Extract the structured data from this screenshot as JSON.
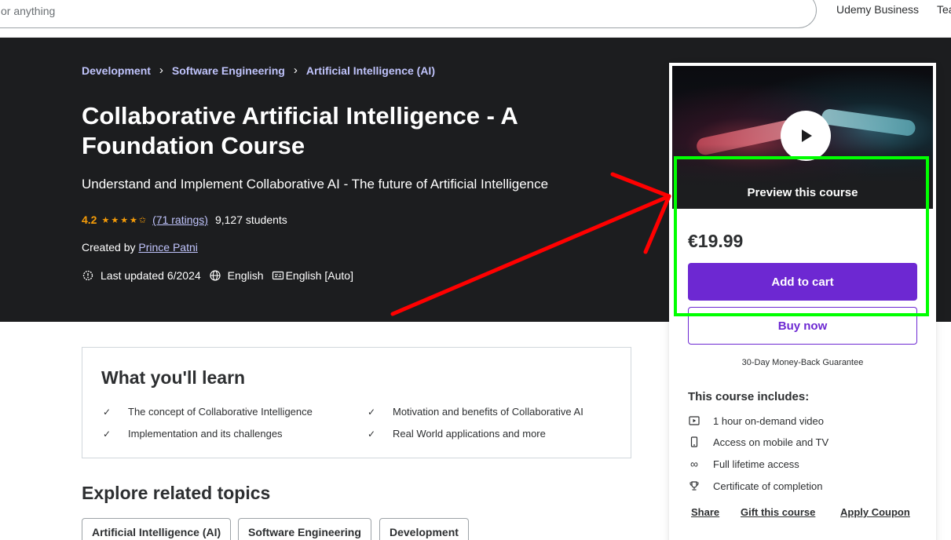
{
  "header": {
    "search_placeholder": "or anything",
    "nav": [
      "Udemy Business",
      "Tea"
    ]
  },
  "breadcrumb": [
    "Development",
    "Software Engineering",
    "Artificial Intelligence (AI)"
  ],
  "course": {
    "title": "Collaborative Artificial Intelligence - A Foundation Course",
    "subtitle": "Understand and Implement Collaborative AI - The future of Artificial Intelligence",
    "rating": "4.2",
    "rating_value": 4.2,
    "ratings_count": "(71 ratings)",
    "students": "9,127 students",
    "created_by_label": "Created by",
    "instructor": "Prince Patni",
    "last_updated": "Last updated 6/2024",
    "language": "English",
    "captions": "English [Auto]"
  },
  "sidebar": {
    "preview_label": "Preview this course",
    "price": "€19.99",
    "add_to_cart": "Add to cart",
    "buy_now": "Buy now",
    "guarantee": "30-Day Money-Back Guarantee",
    "includes_title": "This course includes:",
    "includes": [
      {
        "icon": "video-icon",
        "label": "1 hour on-demand video"
      },
      {
        "icon": "mobile-icon",
        "label": "Access on mobile and TV"
      },
      {
        "icon": "infinity-icon",
        "label": "Full lifetime access"
      },
      {
        "icon": "trophy-icon",
        "label": "Certificate of completion"
      }
    ],
    "links": [
      "Share",
      "Gift this course",
      "Apply Coupon"
    ]
  },
  "learn": {
    "title": "What you'll learn",
    "items": [
      "The concept of Collaborative Intelligence",
      "Motivation and benefits of Collaborative AI",
      "Implementation and its challenges",
      "Real World applications and more"
    ]
  },
  "related": {
    "title": "Explore related topics",
    "topics": [
      "Artificial Intelligence (AI)",
      "Software Engineering",
      "Development"
    ]
  },
  "colors": {
    "hero_bg": "#1c1d1f",
    "accent_purple": "#6d28d2",
    "link_lavender": "#c0c4fc",
    "star_orange": "#f69c08",
    "annotation_red": "#ff0000",
    "annotation_green": "#00ff00"
  }
}
